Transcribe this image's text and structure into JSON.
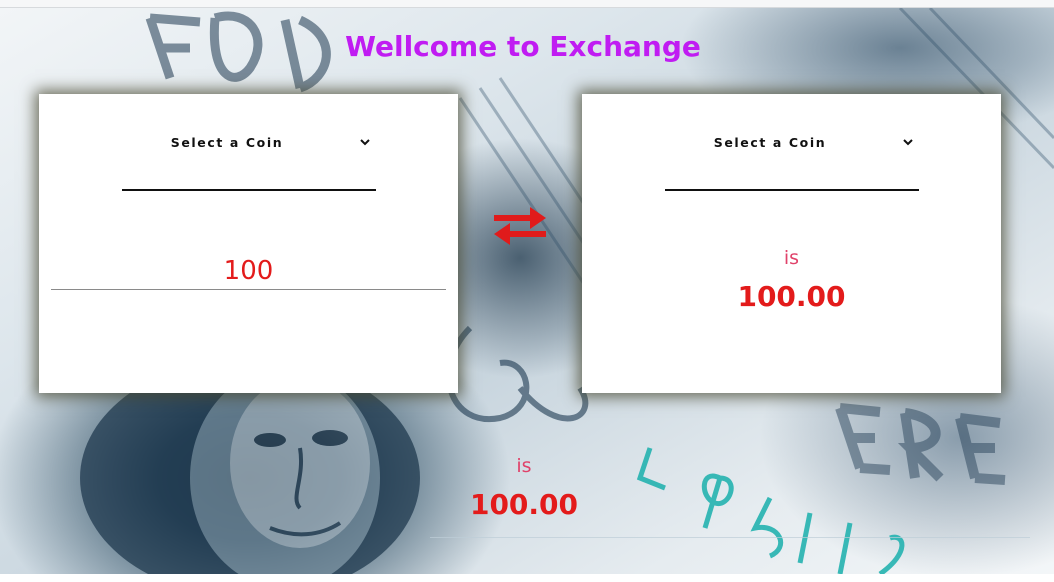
{
  "page": {
    "title": "Wellcome to Exchange"
  },
  "left_card": {
    "coin_select": {
      "label": "Select a Coin",
      "icon": "chevron-down-icon"
    },
    "amount": "100"
  },
  "swap_button": {
    "icon": "swap-arrows-icon",
    "color": "#e01b1b"
  },
  "right_card": {
    "coin_select": {
      "label": "Select a Coin",
      "icon": "chevron-down-icon"
    },
    "result_prefix": "is",
    "result_value": "100.00"
  },
  "bottom_result": {
    "result_prefix": "is",
    "result_value": "100.00"
  },
  "colors": {
    "title": "#c01cf2",
    "amount": "#e31b1b",
    "result_prefix": "#e0426a",
    "result_value": "#e31b1b"
  }
}
